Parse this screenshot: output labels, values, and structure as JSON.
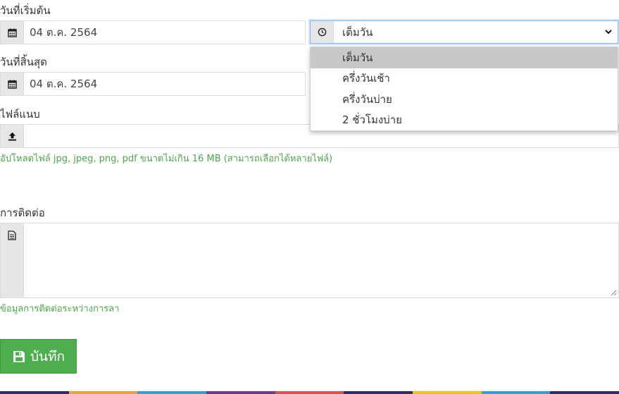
{
  "start_date": {
    "label": "วันที่เริ่มต้น",
    "value": "04 ต.ค. 2564",
    "icon": "calendar-icon"
  },
  "period": {
    "selected": "เต็มวัน",
    "icon": "clock-icon",
    "options": [
      "เต็มวัน",
      "ครึ่งวันเช้า",
      "ครึ่งวันบ่าย",
      "2 ชั่วโมงบ่าย"
    ]
  },
  "end_date": {
    "label": "วันที่สิ้นสุด",
    "value": "04 ต.ค. 2564",
    "icon": "calendar-icon"
  },
  "attachment": {
    "label": "ไฟล์แนบ",
    "help": "อัปโหลดไฟล์ jpg, jpeg, png, pdf ขนาดไม่เกิน 16 MB (สามารถเลือกได้หลายไฟล์)",
    "icon": "upload-icon"
  },
  "contact": {
    "label": "การติดต่อ",
    "value": "",
    "help": "ข้อมูลการติดต่อระหว่างการลา",
    "icon": "document-icon"
  },
  "save_button": {
    "label": "บันทึก",
    "icon": "floppy-disk-icon"
  },
  "colors": {
    "accent_green": "#4cae4c",
    "help_green": "#4aa84a",
    "addon_gray": "#e6e6e6",
    "selected_option": "#c8c8c8"
  }
}
